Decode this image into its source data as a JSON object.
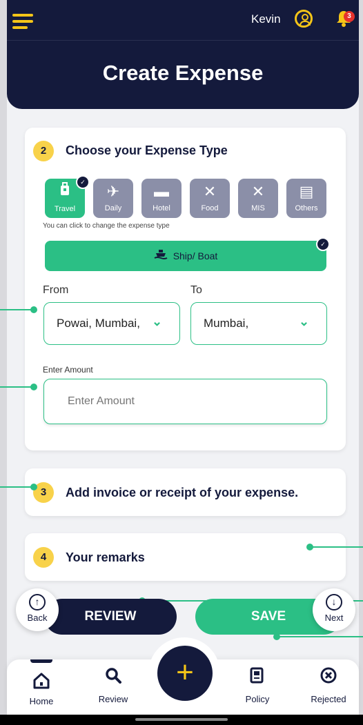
{
  "header": {
    "user_name": "Kevin",
    "notification_count": "3",
    "title": "Create Expense"
  },
  "expense_type": {
    "step": "2",
    "title": "Choose your Expense Type",
    "types": [
      {
        "label": "Travel",
        "icon": "luggage-icon",
        "selected": true
      },
      {
        "label": "Daily",
        "icon": "daily-allowance-icon",
        "selected": false
      },
      {
        "label": "Hotel",
        "icon": "bed-icon",
        "selected": false
      },
      {
        "label": "Food",
        "icon": "fork-knife-icon",
        "selected": false
      },
      {
        "label": "MIS",
        "icon": "fork-knife-icon",
        "selected": false
      },
      {
        "label": "Others",
        "icon": "receipt-icon",
        "selected": false
      }
    ],
    "hint": "You can click to change the expense type",
    "mode_label": "Ship/ Boat",
    "from_label": "From",
    "from_value": "Powai, Mumbai,",
    "to_label": "To",
    "to_value": "Mumbai,",
    "amount_label": "Enter Amount",
    "amount_placeholder": "Enter Amount"
  },
  "invoice": {
    "step": "3",
    "title": "Add invoice or receipt of your expense."
  },
  "remarks": {
    "step": "4",
    "title": "Your remarks"
  },
  "actions": {
    "back_label": "Back",
    "review_label": "REVIEW",
    "save_label": "SAVE",
    "next_label": "Next"
  },
  "bottom_nav": {
    "items": [
      {
        "label": "Home",
        "icon": "home-icon"
      },
      {
        "label": "Review",
        "icon": "search-icon"
      },
      {
        "label": "Policy",
        "icon": "policy-icon"
      },
      {
        "label": "Rejected",
        "icon": "close-circle-icon"
      }
    ],
    "fab_icon": "plus-icon"
  },
  "colors": {
    "navy": "#141a3c",
    "green": "#2bbf85",
    "yellow": "#f5c518",
    "grey_tile": "#8b8fa8"
  }
}
